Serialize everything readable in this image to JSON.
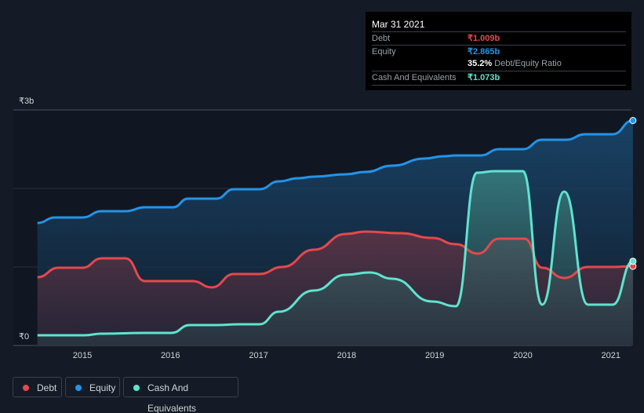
{
  "tooltip": {
    "date": "Mar 31 2021",
    "debt_label": "Debt",
    "debt_value": "₹1.009b",
    "equity_label": "Equity",
    "equity_value": "₹2.865b",
    "ratio_value": "35.2%",
    "ratio_label": "Debt/Equity Ratio",
    "cash_label": "Cash And Equivalents",
    "cash_value": "₹1.073b"
  },
  "legend": [
    {
      "label": "Debt",
      "color": "#e5484d"
    },
    {
      "label": "Equity",
      "color": "#2394e8"
    },
    {
      "label": "Cash And Equivalents",
      "color": "#5fe3cf"
    }
  ],
  "chart_data": {
    "type": "area",
    "ylabel_ticks": [
      "₹0",
      "₹3b"
    ],
    "ylim": [
      0,
      3
    ],
    "xlim": [
      2014.49,
      2021.25
    ],
    "x_ticks": [
      "2015",
      "2016",
      "2017",
      "2018",
      "2019",
      "2020",
      "2021"
    ],
    "series": [
      {
        "name": "Equity",
        "color": "#2394e8",
        "points": [
          [
            2014.49,
            1.56
          ],
          [
            2014.69,
            1.63
          ],
          [
            2015.0,
            1.63
          ],
          [
            2015.22,
            1.71
          ],
          [
            2015.49,
            1.71
          ],
          [
            2015.71,
            1.76
          ],
          [
            2016.03,
            1.76
          ],
          [
            2016.2,
            1.87
          ],
          [
            2016.52,
            1.87
          ],
          [
            2016.72,
            1.99
          ],
          [
            2017.01,
            1.99
          ],
          [
            2017.23,
            2.09
          ],
          [
            2017.45,
            2.13
          ],
          [
            2017.63,
            2.15
          ],
          [
            2017.99,
            2.18
          ],
          [
            2018.21,
            2.21
          ],
          [
            2018.52,
            2.29
          ],
          [
            2018.88,
            2.38
          ],
          [
            2019.1,
            2.41
          ],
          [
            2019.24,
            2.42
          ],
          [
            2019.52,
            2.42
          ],
          [
            2019.73,
            2.5
          ],
          [
            2020.0,
            2.5
          ],
          [
            2020.22,
            2.62
          ],
          [
            2020.49,
            2.62
          ],
          [
            2020.71,
            2.69
          ],
          [
            2021.02,
            2.69
          ],
          [
            2021.25,
            2.865
          ]
        ]
      },
      {
        "name": "Debt",
        "color": "#e5484d",
        "points": [
          [
            2014.49,
            0.87
          ],
          [
            2014.73,
            0.99
          ],
          [
            2015.0,
            0.99
          ],
          [
            2015.22,
            1.11
          ],
          [
            2015.49,
            1.11
          ],
          [
            2015.71,
            0.82
          ],
          [
            2016.25,
            0.82
          ],
          [
            2016.47,
            0.74
          ],
          [
            2016.72,
            0.91
          ],
          [
            2017.01,
            0.91
          ],
          [
            2017.27,
            1.0
          ],
          [
            2017.63,
            1.22
          ],
          [
            2017.99,
            1.42
          ],
          [
            2018.21,
            1.45
          ],
          [
            2018.61,
            1.43
          ],
          [
            2018.97,
            1.37
          ],
          [
            2019.24,
            1.29
          ],
          [
            2019.49,
            1.17
          ],
          [
            2019.73,
            1.36
          ],
          [
            2020.02,
            1.36
          ],
          [
            2020.22,
            0.99
          ],
          [
            2020.47,
            0.86
          ],
          [
            2020.74,
            1.0
          ],
          [
            2021.02,
            1.0
          ],
          [
            2021.25,
            1.009
          ]
        ]
      },
      {
        "name": "Cash And Equivalents",
        "color": "#5fe3cf",
        "points": [
          [
            2014.49,
            0.13
          ],
          [
            2015.02,
            0.13
          ],
          [
            2015.22,
            0.15
          ],
          [
            2015.71,
            0.16
          ],
          [
            2016.01,
            0.16
          ],
          [
            2016.22,
            0.26
          ],
          [
            2016.52,
            0.26
          ],
          [
            2016.78,
            0.27
          ],
          [
            2017.01,
            0.27
          ],
          [
            2017.23,
            0.43
          ],
          [
            2017.63,
            0.7
          ],
          [
            2017.99,
            0.9
          ],
          [
            2018.26,
            0.93
          ],
          [
            2018.52,
            0.85
          ],
          [
            2018.97,
            0.56
          ],
          [
            2019.24,
            0.5
          ],
          [
            2019.48,
            2.2
          ],
          [
            2019.68,
            2.22
          ],
          [
            2020.0,
            2.22
          ],
          [
            2020.22,
            0.52
          ],
          [
            2020.47,
            1.96
          ],
          [
            2020.74,
            0.52
          ],
          [
            2021.02,
            0.52
          ],
          [
            2021.25,
            1.073
          ]
        ]
      }
    ]
  }
}
